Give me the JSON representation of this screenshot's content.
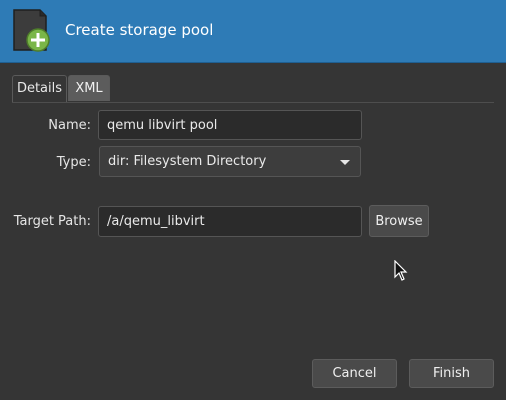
{
  "window": {
    "title": "Create storage pool",
    "icon": "storage-pool-add-icon"
  },
  "tabs": [
    {
      "label": "Details",
      "active": true
    },
    {
      "label": "XML",
      "active": false
    }
  ],
  "form": {
    "name_label": "Name:",
    "name_value": "qemu libvirt pool",
    "type_label": "Type:",
    "type_value": "dir: Filesystem Directory",
    "target_label": "Target Path:",
    "target_value": "/a/qemu_libvirt",
    "browse_label": "Browse"
  },
  "footer": {
    "cancel_label": "Cancel",
    "finish_label": "Finish"
  },
  "colors": {
    "header_bg": "#2e7bb6",
    "dialog_bg": "#353535",
    "icon_green": "#7ab648"
  }
}
